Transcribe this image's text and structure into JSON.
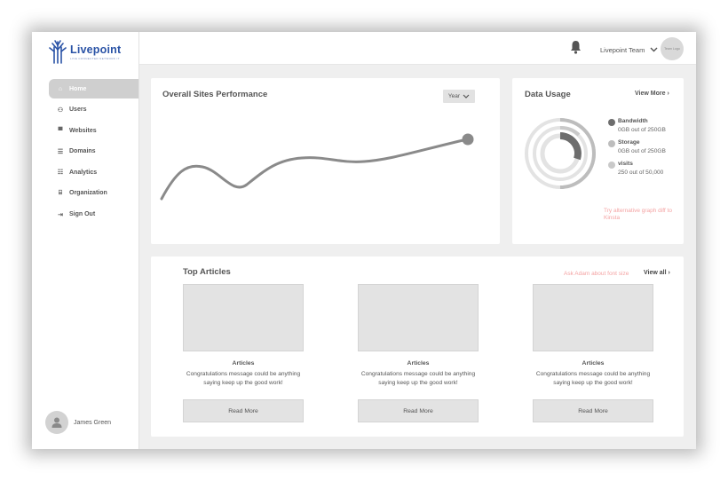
{
  "brand": {
    "name": "Livepoint",
    "tagline": "LIVE CONNECTED NETWORK IT",
    "color": "#2a53a6"
  },
  "sidebar": {
    "items": [
      {
        "label": "Home",
        "icon": "home-icon",
        "glyph": "⌂"
      },
      {
        "label": "Users",
        "icon": "users-icon",
        "glyph": "⚇"
      },
      {
        "label": "Websites",
        "icon": "websites-icon",
        "glyph": "▀"
      },
      {
        "label": "Domains",
        "icon": "domains-icon",
        "glyph": "☰"
      },
      {
        "label": "Analytics",
        "icon": "analytics-icon",
        "glyph": "☷"
      },
      {
        "label": "Organization",
        "icon": "organization-icon",
        "glyph": "⌸"
      },
      {
        "label": "Sign Out",
        "icon": "sign-out-icon",
        "glyph": "⇥"
      }
    ],
    "active_index": 0
  },
  "user": {
    "name": "James Green"
  },
  "topbar": {
    "team_name": "Livepoint Team",
    "team_logo": "Team Logo"
  },
  "performance": {
    "title": "Overall Sites Performance",
    "period": "Year"
  },
  "usage": {
    "title": "Data Usage",
    "view_more": "View More",
    "legend": [
      {
        "name": "Bandwidth",
        "value": "0GB out of 250GB",
        "color": "#6d6d6d"
      },
      {
        "name": "Storage",
        "value": "0GB out of 250GB",
        "color": "#bdbdbd"
      },
      {
        "name": "visits",
        "value": "250 out of 50,000",
        "color": "#c9c9c9"
      }
    ],
    "hint": "Try alternative graph diff to Kinsta"
  },
  "articles": {
    "title": "Top Articles",
    "hint": "Ask Adam about font size",
    "view_all": "View all",
    "items": [
      {
        "title": "Articles",
        "message": "Congratulations message could be anything saying keep up the good work!",
        "button": "Read More"
      },
      {
        "title": "Articles",
        "message": "Congratulations message could be anything saying keep up the good work!",
        "button": "Read More"
      },
      {
        "title": "Articles",
        "message": "Congratulations message could be anything saying keep up the good work!",
        "button": "Read More"
      }
    ]
  }
}
